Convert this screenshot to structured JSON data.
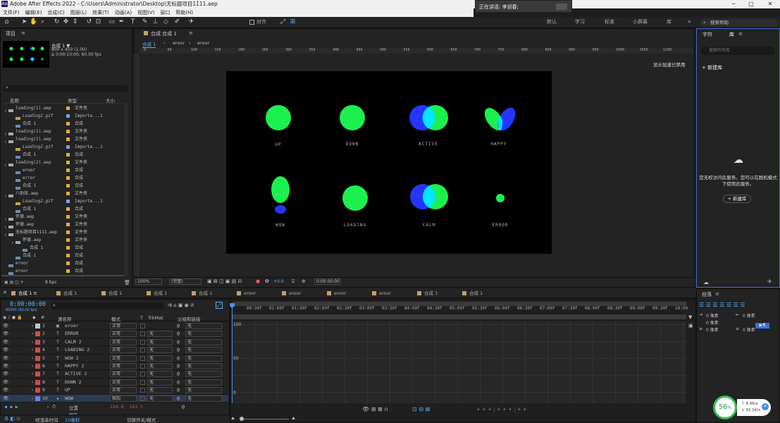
{
  "window": {
    "title": "Adobe After Effects 2022 - C:\\Users\\Administrator\\Desktop\\无标题项目1111.aep",
    "minimize": "─",
    "maximize": "□",
    "close": "✕"
  },
  "talking": {
    "label": "正在讲话: 李迎春;"
  },
  "menu": [
    "文件(F)",
    "编辑(E)",
    "合成(C)",
    "图层(L)",
    "效果(T)",
    "动画(A)",
    "视图(V)",
    "窗口",
    "帮助(H)"
  ],
  "toolbar": {
    "snap_label": "对齐"
  },
  "workspaces": [
    "默认",
    "学习",
    "标准",
    "小屏幕",
    "库"
  ],
  "search_help": {
    "placeholder": "搜索帮助"
  },
  "project": {
    "tab": "项目",
    "comp_name": "合成 1 ▼",
    "comp_size": "800 x 450 (1.00)",
    "comp_duration": "Δ 0:00:10:00, 60.00 fps",
    "col_name": "名称",
    "col_type": "类型",
    "col_size": "大小",
    "bpc": "8 bpc",
    "items": [
      {
        "ind": 0,
        "kind": "folder",
        "name": "loading(1).aep",
        "color": "#d9b33c",
        "type": "文件夹"
      },
      {
        "ind": 1,
        "kind": "gif",
        "name": "Loading2.gif",
        "color": "#7aa7c7",
        "type": "Importe...1"
      },
      {
        "ind": 1,
        "kind": "comp",
        "name": "合成 1",
        "color": "#d9b33c",
        "type": "合成"
      },
      {
        "ind": 0,
        "kind": "folder",
        "name": "loading(1).aep",
        "color": "#d9b33c",
        "type": "文件夹"
      },
      {
        "ind": 0,
        "kind": "folder",
        "name": "loading(1).aep",
        "color": "#d9b33c",
        "type": "文件夹"
      },
      {
        "ind": 1,
        "kind": "gif",
        "name": "Loading2.gif",
        "color": "#7aa7c7",
        "type": "Importe...1"
      },
      {
        "ind": 1,
        "kind": "comp",
        "name": "合成 1",
        "color": "#d9b33c",
        "type": "合成"
      },
      {
        "ind": 0,
        "kind": "folder",
        "name": "loading(2).aep",
        "color": "#d9b33c",
        "type": "文件夹"
      },
      {
        "ind": 1,
        "kind": "comp",
        "name": "eroor",
        "color": "#d9b33c",
        "type": "合成"
      },
      {
        "ind": 1,
        "kind": "comp",
        "name": "error",
        "color": "#d9b33c",
        "type": "合成"
      },
      {
        "ind": 1,
        "kind": "comp",
        "name": "合成 1",
        "color": "#d9b33c",
        "type": "合成"
      },
      {
        "ind": 0,
        "kind": "folder",
        "name": "八助效.aep",
        "color": "#d9b33c",
        "type": "文件夹"
      },
      {
        "ind": 1,
        "kind": "gif",
        "name": "Loading2.gif",
        "color": "#7aa7c7",
        "type": "Importe...1"
      },
      {
        "ind": 1,
        "kind": "comp",
        "name": "合成 1",
        "color": "#d9b33c",
        "type": "合成"
      },
      {
        "ind": 0,
        "kind": "folder",
        "name": "怀德.aep",
        "color": "#d9b33c",
        "type": "文件夹"
      },
      {
        "ind": 0,
        "kind": "folder",
        "name": "怀德.aep",
        "color": "#d9b33c",
        "type": "文件夹"
      },
      {
        "ind": 0,
        "kind": "folder",
        "name": "无标题项目1111.aep",
        "color": "#d9b33c",
        "type": "文件夹"
      },
      {
        "ind": 1,
        "kind": "folder",
        "name": "怀德.aep",
        "color": "#d9b33c",
        "type": "文件夹"
      },
      {
        "ind": 2,
        "kind": "comp",
        "name": "合成 1",
        "color": "#d9b33c",
        "type": "合成"
      },
      {
        "ind": 1,
        "kind": "comp",
        "name": "合成 1",
        "color": "#d9b33c",
        "type": "合成"
      },
      {
        "ind": 0,
        "kind": "comp",
        "name": "eroor",
        "color": "#d9b33c",
        "type": "合成"
      },
      {
        "ind": 0,
        "kind": "comp",
        "name": "eroor",
        "color": "#d9b33c",
        "type": "合成"
      },
      {
        "ind": 0,
        "kind": "comp",
        "name": "",
        "color": "#d9b33c",
        "type": "合成"
      }
    ]
  },
  "composition": {
    "tab": "合成 合成 1",
    "crumbs": [
      "合成 1",
      "eroor",
      "eroor"
    ],
    "accel_notice": "显示加速已禁用",
    "labels": [
      "UP",
      "DOWN",
      "ACTIVE",
      "HAPPY",
      "WOW",
      "LOADING",
      "CALM",
      "ERROR"
    ],
    "zoom": "100%",
    "quality": "(完整)",
    "exposure": "+0.0",
    "timecode": "0:00:00:00",
    "ruler": [
      "0",
      "50",
      "100",
      "150",
      "200",
      "250",
      "300",
      "350",
      "400",
      "450",
      "500",
      "550",
      "600",
      "650",
      "700",
      "750",
      "800",
      "850",
      "900",
      "950",
      "1000",
      "1050",
      "1100"
    ]
  },
  "library": {
    "tab_char": "字符",
    "tab_lib": "库",
    "search_placeholder": "搜索所有库",
    "new_lib": "+ 新建库",
    "offline_msg": "您无权访问此服务。您可以在脱机模式下使用此服务。",
    "new_lib_btn": "+ 新建库"
  },
  "paragraph": {
    "tab": "段落",
    "px_values": [
      "0 像素",
      "0 像素",
      "0 像素",
      "0 像素",
      "0 像素"
    ]
  },
  "timeline": {
    "tabs": [
      "合成 1",
      "合成 1",
      "合成 1",
      "合成 1",
      "合成 1",
      "eroor",
      "eroor",
      "eroor",
      "eroor",
      "合成 1",
      "合成 1"
    ],
    "timecode": "0:00:00:00",
    "fps_sub": "00000 (60.00 fps)",
    "headers": {
      "name": "源名称",
      "mode": "模式",
      "t": "T",
      "trkmat": "TrkMat",
      "parent": "父级和链接"
    },
    "layers": [
      {
        "num": "1",
        "name": "eroor",
        "color": "#c5c5c5",
        "type": "comp",
        "mode": "正常",
        "trk": "",
        "parent": "无"
      },
      {
        "num": "2",
        "name": "ERROR",
        "color": "#d14b4b",
        "type": "T",
        "mode": "正常",
        "trk": "无",
        "parent": "无"
      },
      {
        "num": "3",
        "name": "CALM 2",
        "color": "#d14b4b",
        "type": "T",
        "mode": "正常",
        "trk": "无",
        "parent": "无"
      },
      {
        "num": "4",
        "name": "LOADING 2",
        "color": "#d14b4b",
        "type": "T",
        "mode": "正常",
        "trk": "无",
        "parent": "无"
      },
      {
        "num": "5",
        "name": "WOW 2",
        "color": "#d14b4b",
        "type": "T",
        "mode": "正常",
        "trk": "无",
        "parent": "无"
      },
      {
        "num": "6",
        "name": "HAPPY 2",
        "color": "#d14b4b",
        "type": "T",
        "mode": "正常",
        "trk": "无",
        "parent": "无"
      },
      {
        "num": "7",
        "name": "ACTIVE 2",
        "color": "#d14b4b",
        "type": "T",
        "mode": "正常",
        "trk": "无",
        "parent": "无"
      },
      {
        "num": "8",
        "name": "DOWN 2",
        "color": "#d14b4b",
        "type": "T",
        "mode": "正常",
        "trk": "无",
        "parent": "无"
      },
      {
        "num": "9",
        "name": "UP",
        "color": "#d14b4b",
        "type": "T",
        "mode": "正常",
        "trk": "无",
        "parent": "无"
      },
      {
        "num": "10",
        "name": "WOW",
        "color": "#6f7fd6",
        "type": "★",
        "mode": "相加",
        "trk": "无",
        "parent": "无"
      }
    ],
    "position_label": "位置",
    "position_value": "124.0, 163.5",
    "next_label": "缩放",
    "ruler": [
      "00:30f",
      "01:00f",
      "01:30f",
      "02:00f",
      "02:30f",
      "03:00f",
      "03:30f",
      "04:00f",
      "04:30f",
      "05:00f",
      "05:30f",
      "06:00f",
      "06:30f",
      "07:00f",
      "07:30f",
      "08:00f",
      "08:30f",
      "09:00f",
      "09:30f",
      "10:00"
    ],
    "graph_labels": [
      "100",
      "50",
      "0"
    ],
    "footer_render": "帧渲染时间",
    "footer_ms": "10毫秒",
    "footer_switch": "切换开关/模式"
  },
  "network": {
    "percent": "56",
    "up": "4.4K/s",
    "down": "32.1K/s"
  }
}
